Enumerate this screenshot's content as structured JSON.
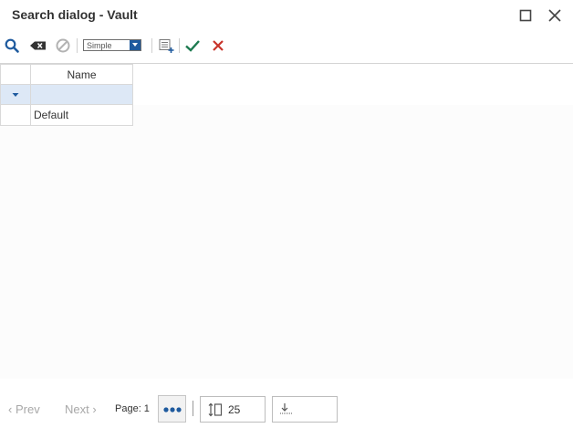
{
  "window": {
    "title": "Search dialog - Vault"
  },
  "toolbar": {
    "search_mode": "Simple"
  },
  "grid": {
    "columns": [
      "Name"
    ],
    "rows": [
      {
        "name": "Default"
      }
    ]
  },
  "pager": {
    "prev_label": "Prev",
    "next_label": "Next",
    "page_label": "Page: 1",
    "page_size": "25"
  },
  "colors": {
    "accent_blue": "#1e5a9e",
    "confirm_green": "#1d7a50",
    "cancel_red": "#c8342b",
    "filter_row": "#dde8f6"
  }
}
